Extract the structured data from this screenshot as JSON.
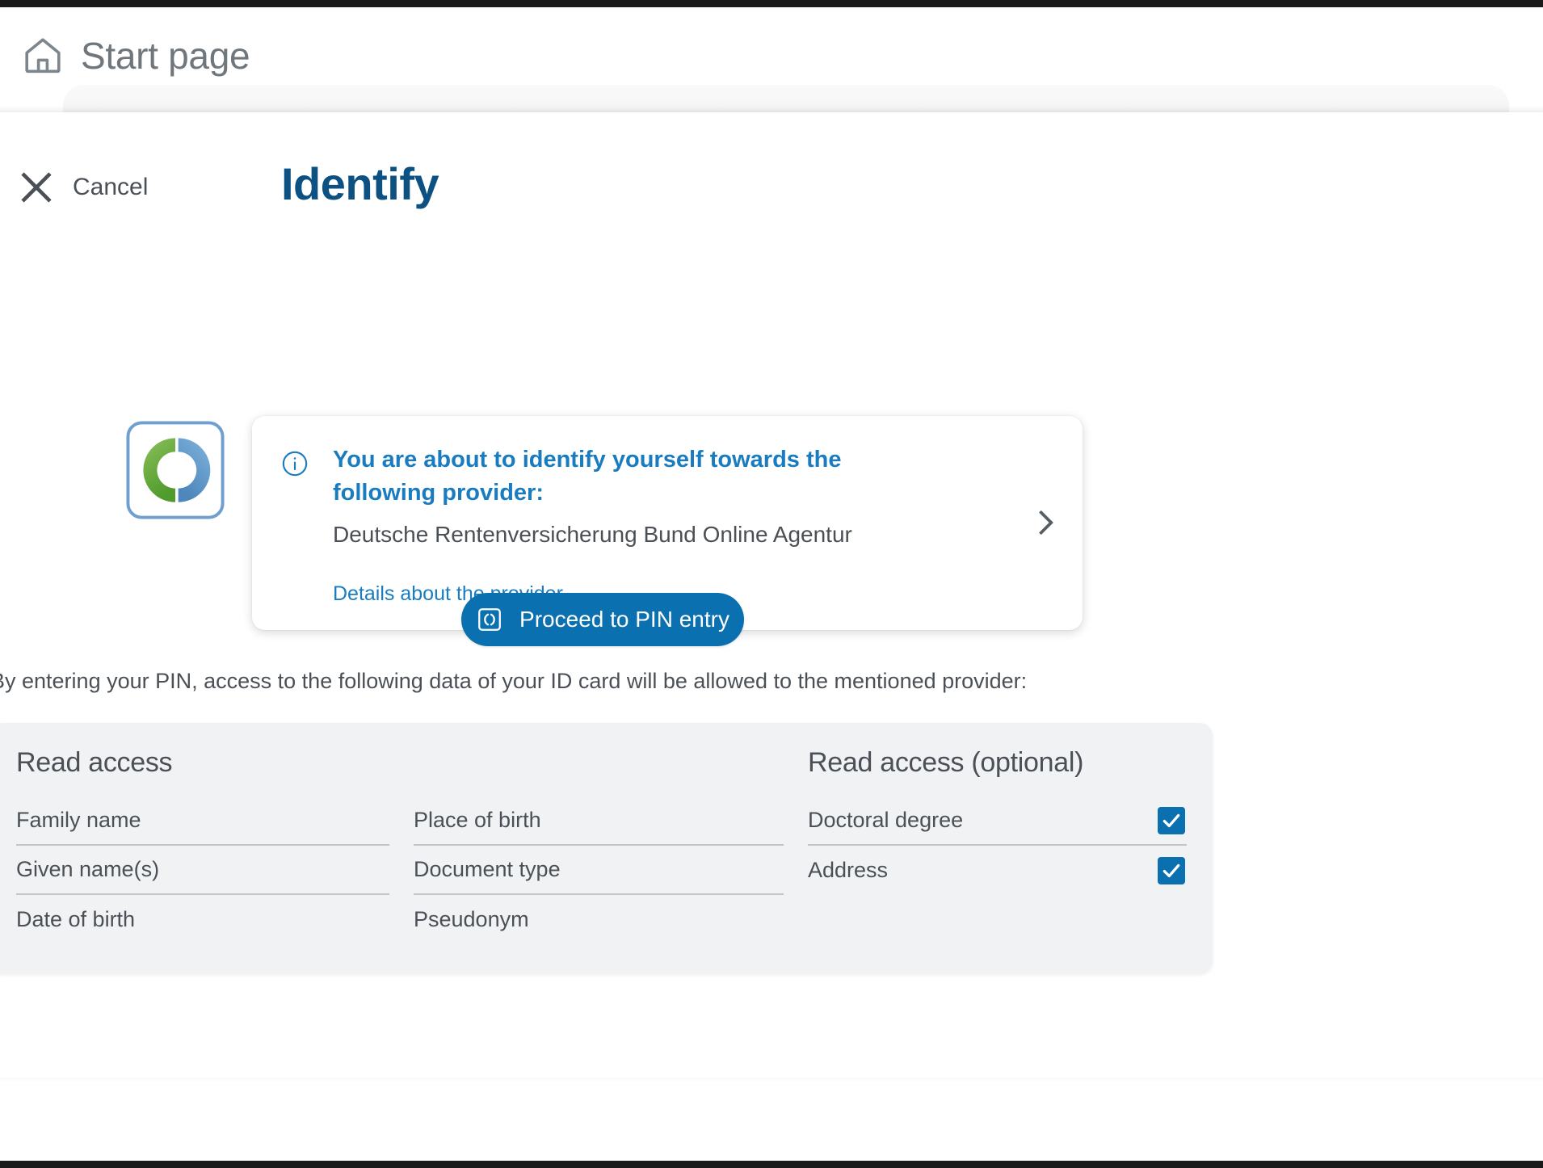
{
  "topbar": {
    "title": "Start page",
    "home_icon": "home-icon"
  },
  "dialog": {
    "cancel_label": "Cancel",
    "close_icon": "close-icon",
    "title": "Identify"
  },
  "provider_card": {
    "info_icon": "info-circle-icon",
    "headline": "You are about to identify yourself towards the following provider:",
    "provider_name": "Deutsche Rentenversicherung Bund Online Agentur",
    "details_link": "Details about the provider",
    "chevron_icon": "chevron-right-icon",
    "logo_icon": "provider-ring-logo"
  },
  "action": {
    "pin_button_label": "Proceed to PIN entry",
    "pin_button_icon": "id-card-icon"
  },
  "description": "By entering your PIN, access to the following data of your ID card will be allowed to the mentioned provider:",
  "data_panel": {
    "required_heading": "Read access",
    "optional_heading": "Read access (optional)",
    "column_a": [
      {
        "label": "Family name"
      },
      {
        "label": "Given name(s)"
      },
      {
        "label": "Date of birth"
      }
    ],
    "column_b": [
      {
        "label": "Place of birth"
      },
      {
        "label": "Document type"
      },
      {
        "label": "Pseudonym"
      }
    ],
    "column_optional": [
      {
        "label": "Doctoral degree",
        "checked": true
      },
      {
        "label": "Address",
        "checked": true
      }
    ]
  },
  "colors": {
    "primary_blue": "#0b70b0",
    "title_navy": "#0c5182",
    "link_blue": "#1a7cc0",
    "text_gray": "#4a5056",
    "panel_bg": "#f1f2f4",
    "logo_green": "#6aab3f",
    "logo_blue": "#5e98ca"
  }
}
